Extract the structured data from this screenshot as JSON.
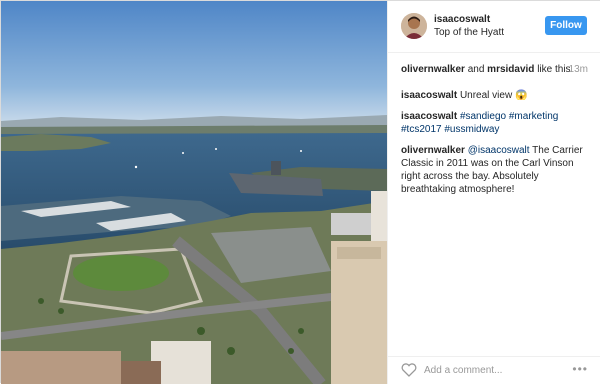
{
  "post": {
    "username": "isaacoswalt",
    "location": "Top of the Hyatt",
    "follow_label": "Follow",
    "likes": {
      "user1": "olivernwalker",
      "and": "and",
      "user2": "mrsidavid",
      "suffix": "like this"
    },
    "timestamp": "13m",
    "comments": [
      {
        "user": "isaacoswalt",
        "text": "Unreal view 😱"
      },
      {
        "user": "isaacoswalt",
        "tags": "#sandiego #marketing #tcs2017 #ussmidway"
      },
      {
        "user": "olivernwalker",
        "mention": "@isaacoswalt",
        "text": "The Carrier Classic in 2011 was on the Carl Vinson right across the bay. Absolutely breathtaking atmosphere!"
      }
    ],
    "add_comment_placeholder": "Add a comment...",
    "more_label": "•••"
  },
  "icons": {
    "heart": "heart-icon",
    "more": "more-options-icon"
  },
  "colors": {
    "follow": "#3897f0",
    "link": "#003569"
  }
}
